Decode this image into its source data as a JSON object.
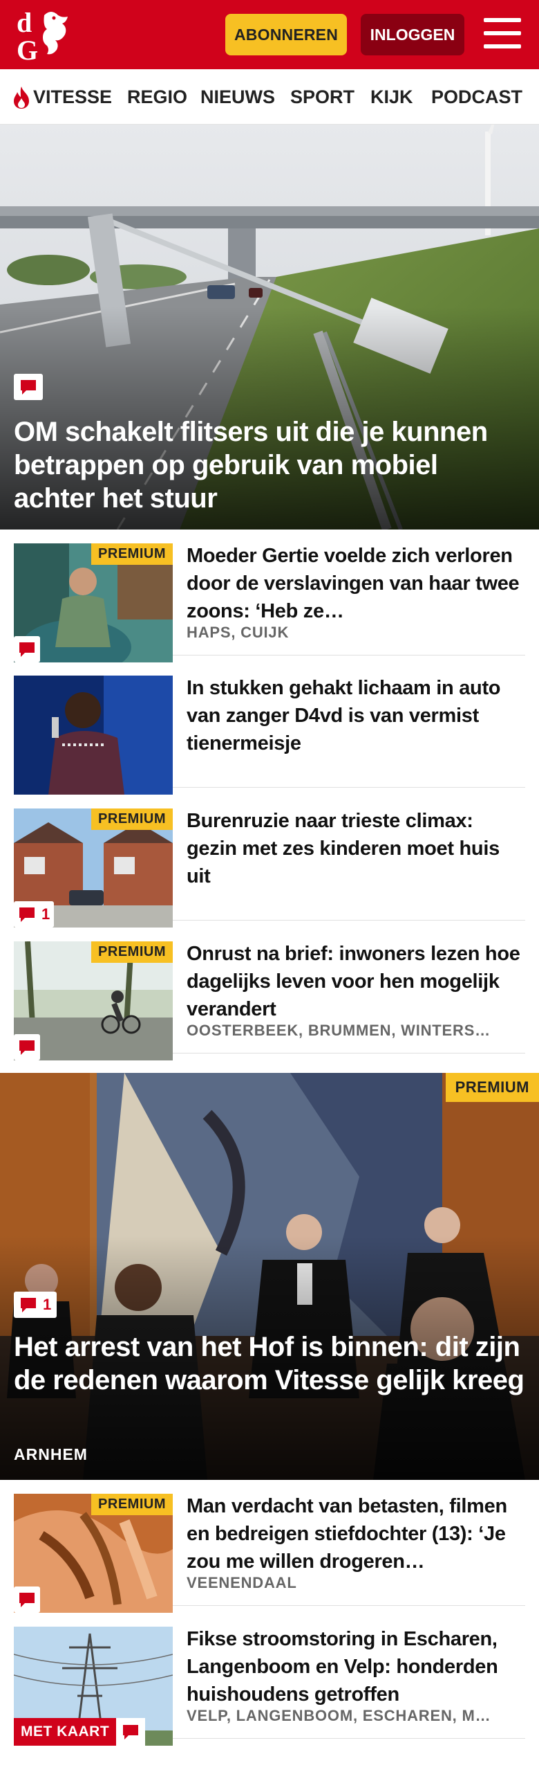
{
  "header": {
    "logo_text": "dG",
    "subscribe_label": "ABONNEREN",
    "login_label": "INLOGGEN",
    "brand_color": "#d0021b",
    "accent_color": "#f7c023"
  },
  "nav": {
    "items": [
      {
        "label": "VITESSE",
        "icon": "flame-icon"
      },
      {
        "label": "REGIO"
      },
      {
        "label": "NIEUWS"
      },
      {
        "label": "SPORT"
      },
      {
        "label": "KIJK"
      },
      {
        "label": "PODCAST"
      }
    ]
  },
  "hero": {
    "title": "OM schakelt flitsers uit die je kunnen betrappen op gebruik van mobiel achter het stuur",
    "comment_icon": "comment-icon"
  },
  "articles": [
    {
      "premium": "PREMIUM",
      "title": "Moeder Gertie voelde zich verloren door de verslavingen van haar twee zoons: ‘Heb ze…",
      "location": "HAPS, CUIJK",
      "comments": ""
    },
    {
      "premium": "",
      "title": "In stukken gehakt lichaam in auto van zanger D4vd is van vermist tienermeisje",
      "location": "",
      "comments": ""
    },
    {
      "premium": "PREMIUM",
      "title": "Burenruzie naar trieste climax: gezin met zes kinderen moet huis uit",
      "location": "",
      "comments": "1"
    },
    {
      "premium": "PREMIUM",
      "title": "Onrust na brief: inwoners lezen hoe dagelijks leven voor hen mogelijk verandert",
      "location": "OOSTERBEEK, BRUMMEN, WINTERS…",
      "comments": ""
    }
  ],
  "feature": {
    "premium": "PREMIUM",
    "title": "Het arrest van het Hof is binnen: dit zijn de redenen waarom Vitesse gelijk kreeg",
    "location": "ARNHEM",
    "comments": "1"
  },
  "articles2": [
    {
      "premium": "PREMIUM",
      "title": "Man verdacht van betasten, filmen en bedreigen stiefdochter (13): ‘Je zou me willen drogeren…",
      "location": "VEENENDAAL",
      "comments": ""
    },
    {
      "premium": "",
      "title": "Fikse stroomstoring in Escharen, Langenboom en Velp: honderden huishoudens getroffen",
      "location": "VELP, LANGENBOOM, ESCHAREN, M…",
      "map_label": "MET KAART"
    }
  ]
}
